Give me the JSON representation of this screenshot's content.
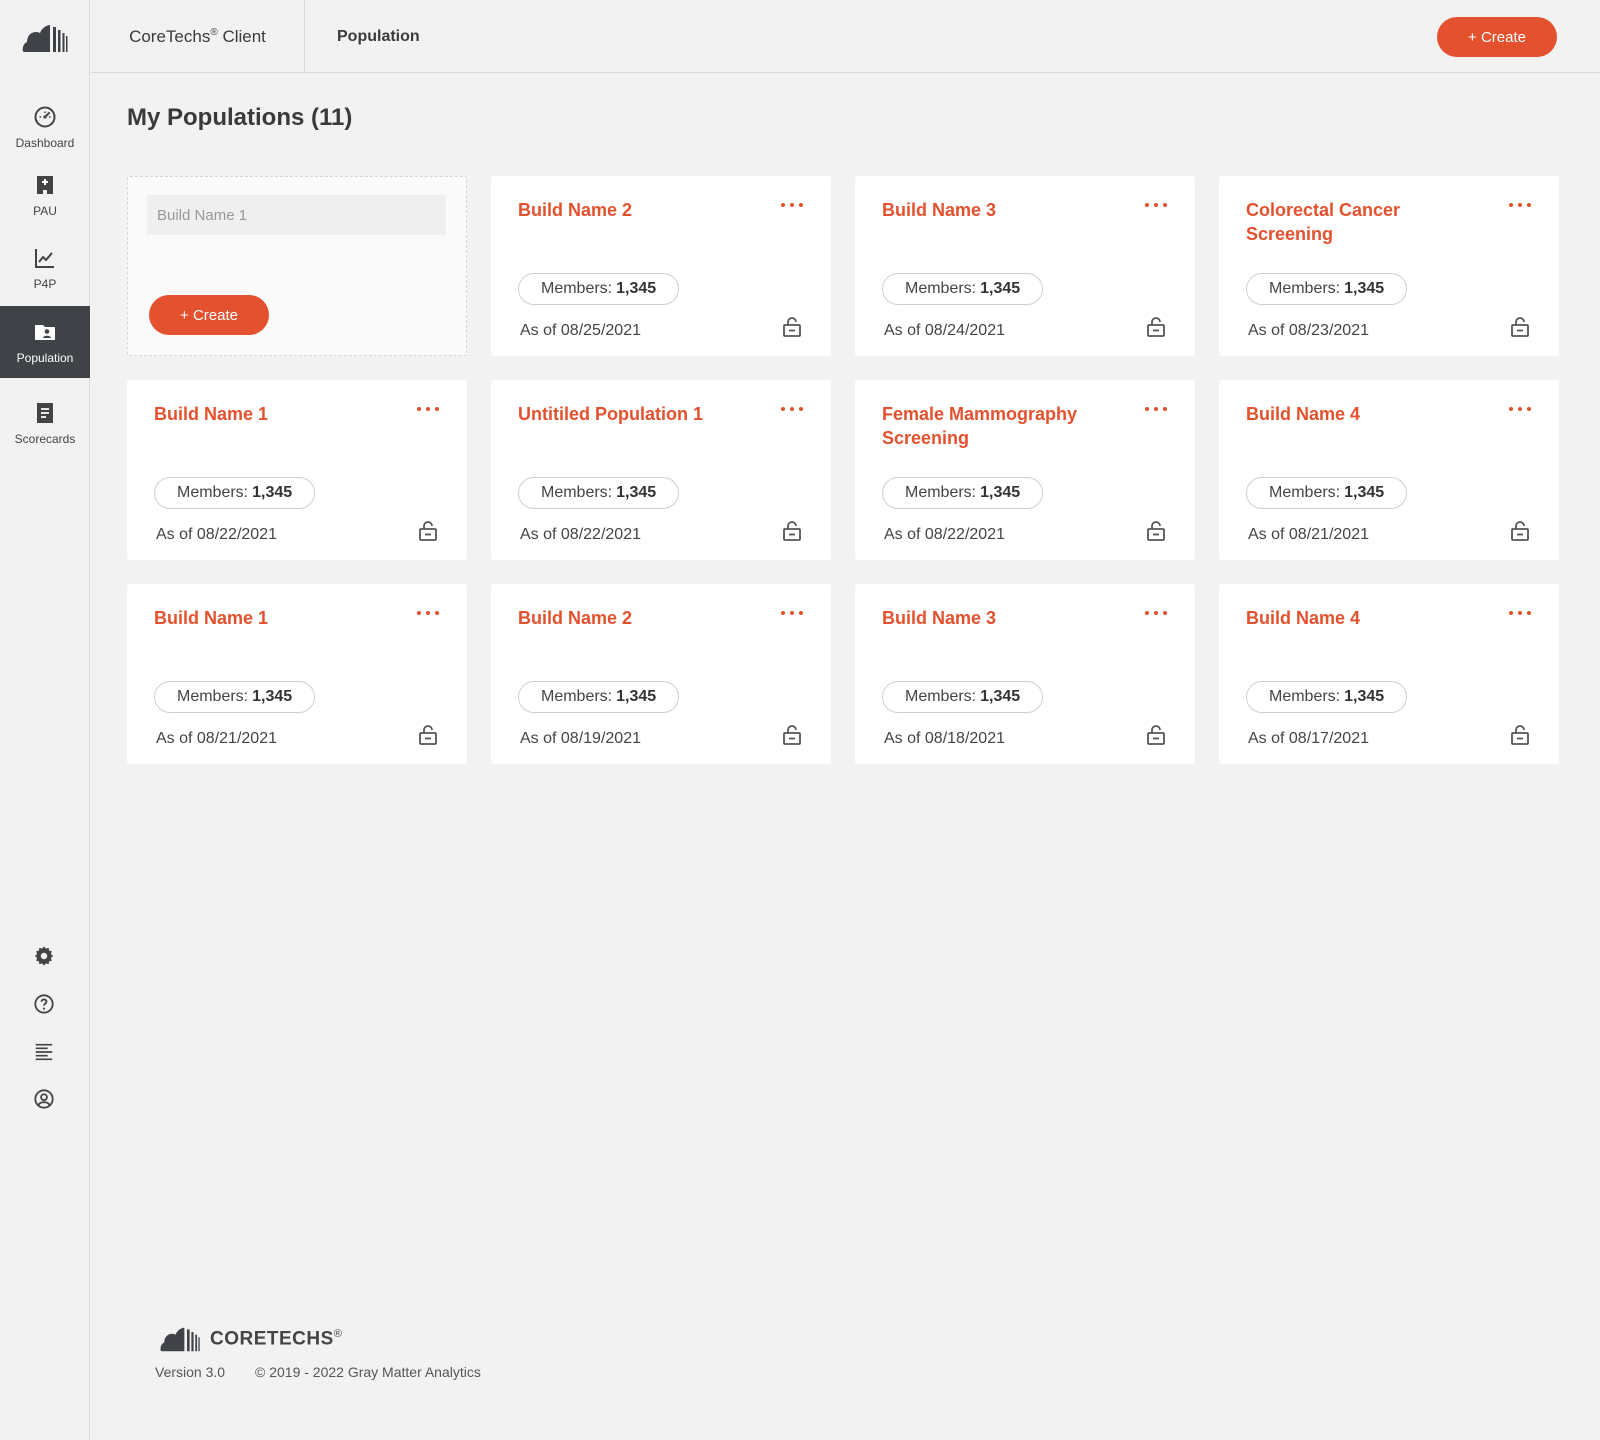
{
  "sidebar": {
    "items": [
      {
        "label": "Dashboard",
        "icon": "gauge-icon"
      },
      {
        "label": "PAU",
        "icon": "building-icon"
      },
      {
        "label": "P4P",
        "icon": "chart-line-icon"
      },
      {
        "label": "Population",
        "icon": "folder-user-icon"
      },
      {
        "label": "Scorecards",
        "icon": "document-icon"
      }
    ],
    "bottom_icons": [
      "gear-icon",
      "help-icon",
      "list-icon",
      "user-circle-icon"
    ]
  },
  "header": {
    "app_name": "CoreTechs",
    "app_sup": "®",
    "app_suffix": " Client",
    "breadcrumb": "Population",
    "create_label": "+ Create"
  },
  "main": {
    "title": "My Populations (11)",
    "new_card": {
      "placeholder": "Build Name 1",
      "create_label": "+ Create"
    },
    "members_label": "Members:",
    "cards": [
      {
        "title": "Build Name 2",
        "members": "1,345",
        "as_of": "As of 08/25/2021"
      },
      {
        "title": "Build Name 3",
        "members": "1,345",
        "as_of": "As of 08/24/2021"
      },
      {
        "title": "Colorectal Cancer Screening",
        "members": "1,345",
        "as_of": "As of 08/23/2021"
      },
      {
        "title": "Build Name 1",
        "members": "1,345",
        "as_of": "As of 08/22/2021"
      },
      {
        "title": "Untitiled Population 1",
        "members": "1,345",
        "as_of": "As of 08/22/2021"
      },
      {
        "title": "Female Mammography Screening",
        "members": "1,345",
        "as_of": "As of 08/22/2021"
      },
      {
        "title": "Build Name 4",
        "members": "1,345",
        "as_of": "As of 08/21/2021"
      },
      {
        "title": "Build Name 1",
        "members": "1,345",
        "as_of": "As of 08/21/2021"
      },
      {
        "title": "Build Name 2",
        "members": "1,345",
        "as_of": "As of 08/19/2021"
      },
      {
        "title": "Build Name 3",
        "members": "1,345",
        "as_of": "As of 08/18/2021"
      },
      {
        "title": "Build Name 4",
        "members": "1,345",
        "as_of": "As of 08/17/2021"
      }
    ]
  },
  "footer": {
    "brand": "CORETECHS",
    "brand_sup": "®",
    "version": "Version 3.0",
    "copyright": "© 2019 - 2022 Gray Matter Analytics"
  },
  "colors": {
    "accent": "#e4512e",
    "sidebar_active": "#3f4246",
    "background": "#f2f2f2"
  }
}
